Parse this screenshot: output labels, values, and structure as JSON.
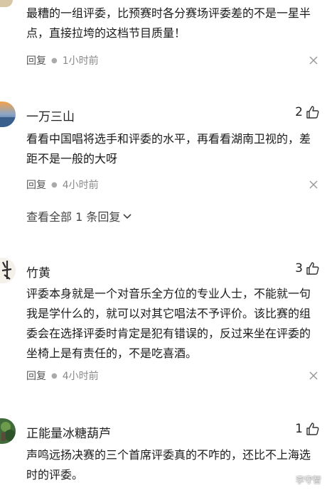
{
  "comments": [
    {
      "text": "最糟的一组评委，比预赛时各分赛场评委差的不是一星半点，直接拉垮的这档节目质量！",
      "reply_label": "回复",
      "time": "1小时前"
    },
    {
      "username": "一万三山",
      "likes": "2",
      "text": "看看中国唱将选手和评委的水平，再看看湖南卫视的，差距不是一般的大呀",
      "reply_label": "回复",
      "time": "4小时前"
    },
    {
      "username": "竹黄",
      "likes": "3",
      "text": "评委本身就是一个对音乐全方位的专业人士，不能就一句我是学什么的，就可以对其它唱法不予评价。该比赛的组委会在选择评委时肯定是犯有错误的，反过来坐在评委的坐椅上是有责任的，不是吃喜酒。",
      "reply_label": "回复",
      "time": "4小时前"
    },
    {
      "username": "正能量冰糖葫芦",
      "likes": "1",
      "text": "声鸣远扬决赛的三个首席评委真的不咋的，还比不上海选时的评委。"
    }
  ],
  "expand_replies": {
    "label": "查看全部 1 条回复"
  },
  "watermark": "李守智",
  "icons": {
    "close": "close-icon",
    "like": "thumbs-up-icon",
    "expand": "chevron-down-icon"
  }
}
